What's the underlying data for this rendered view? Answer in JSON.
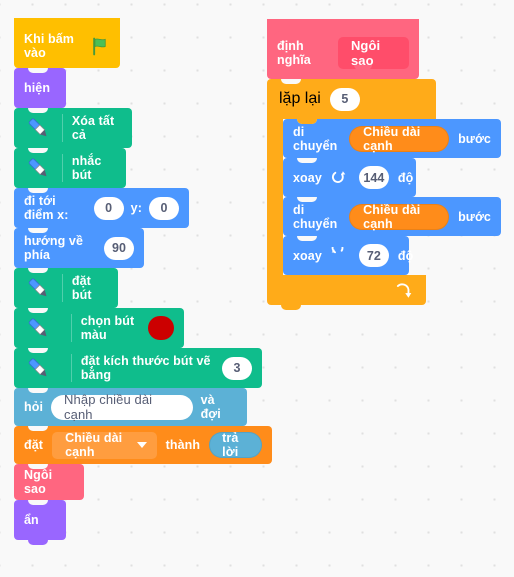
{
  "app": {
    "name": "scratch-block-editor",
    "language": "vi"
  },
  "colors": {
    "events": "#ffbf00",
    "looks": "#9966ff",
    "pen": "#0fbd8c",
    "motion": "#4c97ff",
    "sensing": "#5cb1d6",
    "variables": "#ff8c1a",
    "my_blocks": "#ff6680",
    "control": "#ffab19",
    "pen_color_swatch": "#cc0000",
    "canvas": "#f9f9f9"
  },
  "main_script": {
    "name": "main-script-stack",
    "blocks": {
      "when_flag_clicked": {
        "label": "Khi bấm vào",
        "icon": "green-flag-icon"
      },
      "show": {
        "label": "hiện"
      },
      "erase_all": {
        "label": "Xóa tất cả",
        "icon": "pen-icon"
      },
      "pen_up": {
        "label": "nhắc bút",
        "icon": "pen-icon"
      },
      "go_to_xy": {
        "label_prefix": "đi tới điểm x:",
        "x_value": "0",
        "label_mid": "y:",
        "y_value": "0"
      },
      "point_in_direction": {
        "label": "hướng về phía",
        "value": "90"
      },
      "pen_down": {
        "label": "đặt bút",
        "icon": "pen-icon"
      },
      "set_pen_color": {
        "label": "chọn bút màu",
        "icon": "pen-icon",
        "swatch": "#cc0000"
      },
      "set_pen_size": {
        "label": "đặt kích thước bút vẽ bằng",
        "icon": "pen-icon",
        "value": "3"
      },
      "ask_and_wait": {
        "label_prefix": "hỏi",
        "question": "Nhập chiều dài cạnh",
        "label_suffix": "và đợi"
      },
      "set_variable": {
        "label_prefix": "đặt",
        "variable": "Chiều dài cạnh",
        "label_mid": "thành",
        "value_reporter": "trả lời"
      },
      "call_custom_block": {
        "label": "Ngôi sao"
      },
      "hide": {
        "label": "ẩn"
      }
    }
  },
  "definition_script": {
    "name": "procedure-definition-stack",
    "blocks": {
      "define": {
        "label": "định nghĩa",
        "procedure_name": "Ngôi sao"
      },
      "repeat": {
        "label": "lặp lại",
        "times": "5",
        "loop_icon": "loop-arrow-icon"
      },
      "move_1": {
        "label_prefix": "di chuyển",
        "variable": "Chiều dài cạnh",
        "label_suffix": "bước"
      },
      "turn_right": {
        "label_prefix": "xoay",
        "icon": "turn-clockwise-icon",
        "degrees": "144",
        "label_suffix": "độ"
      },
      "move_2": {
        "label_prefix": "di chuyển",
        "variable": "Chiều dài cạnh",
        "label_suffix": "bước"
      },
      "turn_left": {
        "label_prefix": "xoay",
        "icon": "turn-counterclockwise-icon",
        "degrees": "72",
        "label_suffix": "độ"
      }
    }
  }
}
